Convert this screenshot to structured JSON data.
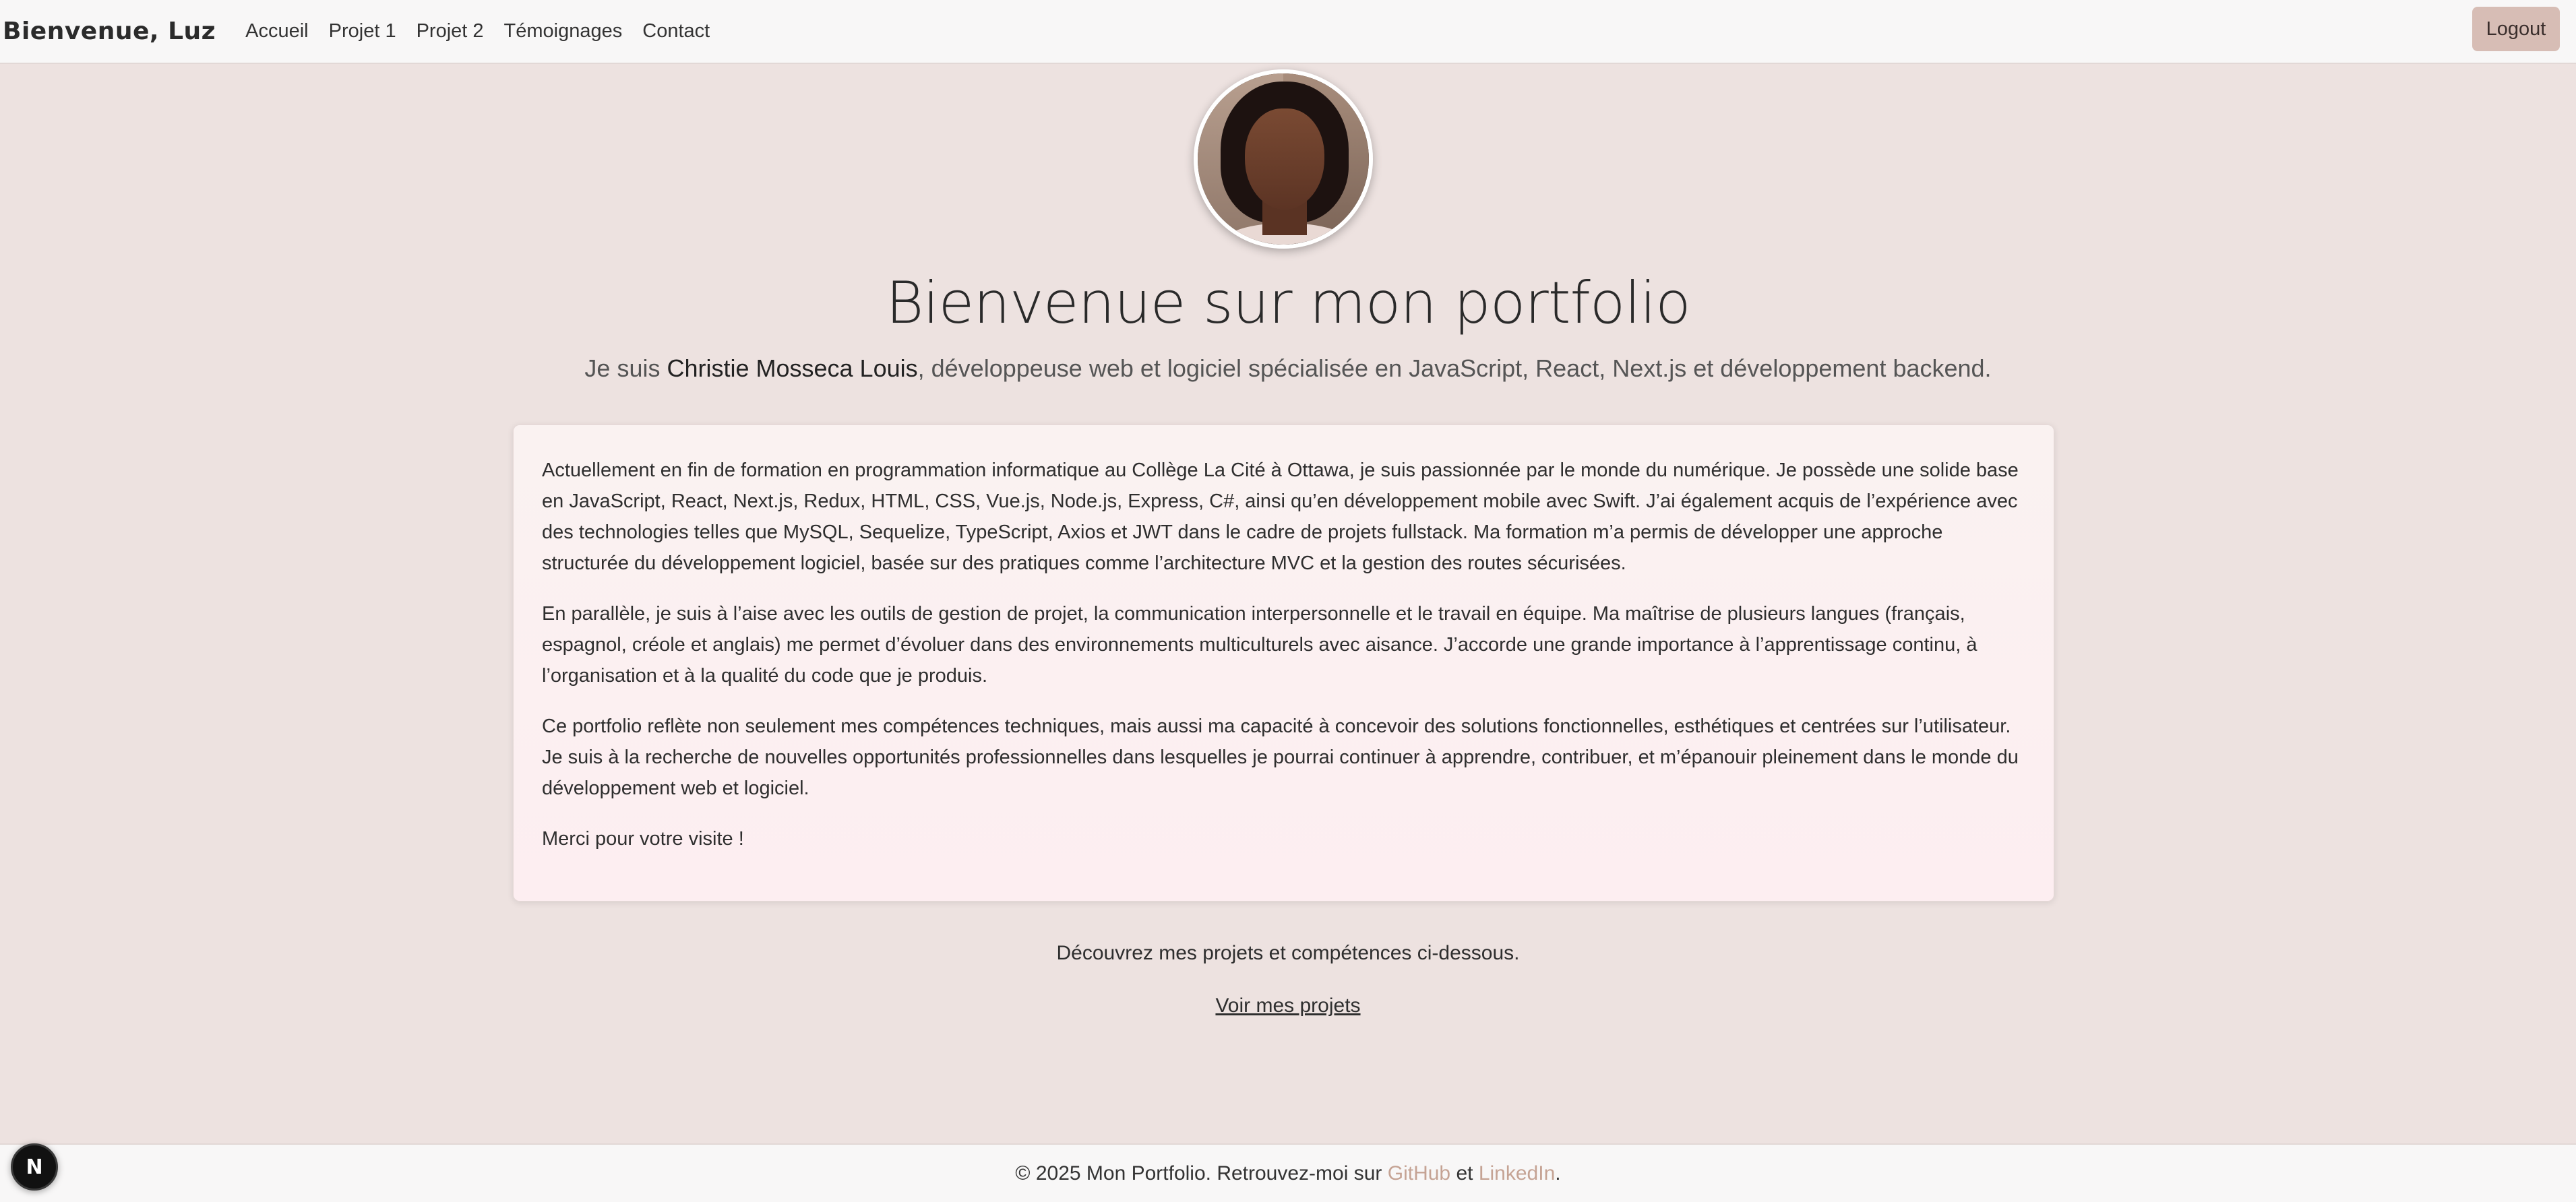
{
  "navbar": {
    "brand": "Bienvenue, Luz",
    "links": [
      "Accueil",
      "Projet 1",
      "Projet 2",
      "Témoignages",
      "Contact"
    ],
    "logout_label": "Logout"
  },
  "hero": {
    "title": "Bienvenue sur mon portfolio",
    "subtitle_prefix": "Je suis ",
    "subtitle_name": "Christie Mosseca Louis",
    "subtitle_suffix": ", développeuse web et logiciel spécialisée en JavaScript, React, Next.js et développement backend."
  },
  "about": {
    "paragraphs": [
      "Actuellement en fin de formation en programmation informatique au Collège La Cité à Ottawa, je suis passionnée par le monde du numérique. Je possède une solide base en JavaScript, React, Next.js, Redux, HTML, CSS, Vue.js, Node.js, Express, C#, ainsi qu’en développement mobile avec Swift. J’ai également acquis de l’expérience avec des technologies telles que MySQL, Sequelize, TypeScript, Axios et JWT dans le cadre de projets fullstack. Ma formation m’a permis de développer une approche structurée du développement logiciel, basée sur des pratiques comme l’architecture MVC et la gestion des routes sécurisées.",
      "En parallèle, je suis à l’aise avec les outils de gestion de projet, la communication interpersonnelle et le travail en équipe. Ma maîtrise de plusieurs langues (français, espagnol, créole et anglais) me permet d’évoluer dans des environnements multiculturels avec aisance. J’accorde une grande importance à l’apprentissage continu, à l’organisation et à la qualité du code que je produis.",
      "Ce portfolio reflète non seulement mes compétences techniques, mais aussi ma capacité à concevoir des solutions fonctionnelles, esthétiques et centrées sur l’utilisateur. Je suis à la recherche de nouvelles opportunités professionnelles dans lesquelles je pourrai continuer à apprendre, contribuer, et m’épanouir pleinement dans le monde du développement web et logiciel.",
      "Merci pour votre visite !"
    ]
  },
  "cta": {
    "discover_text": "Découvrez mes projets et compétences ci-dessous.",
    "projects_link": "Voir mes projets"
  },
  "footer": {
    "prefix": "© 2025 Mon Portfolio. Retrouvez-moi sur ",
    "github": "GitHub",
    "middle": " et ",
    "linkedin": "LinkedIn",
    "suffix": "."
  },
  "next_badge": {
    "letter": "N",
    "icon": "nextjs-icon"
  },
  "colors": {
    "background": "#ede2e0",
    "navbar": "#f8f7f7",
    "logout_button": "#d7bdb5",
    "footer_link": "#c5a394"
  }
}
